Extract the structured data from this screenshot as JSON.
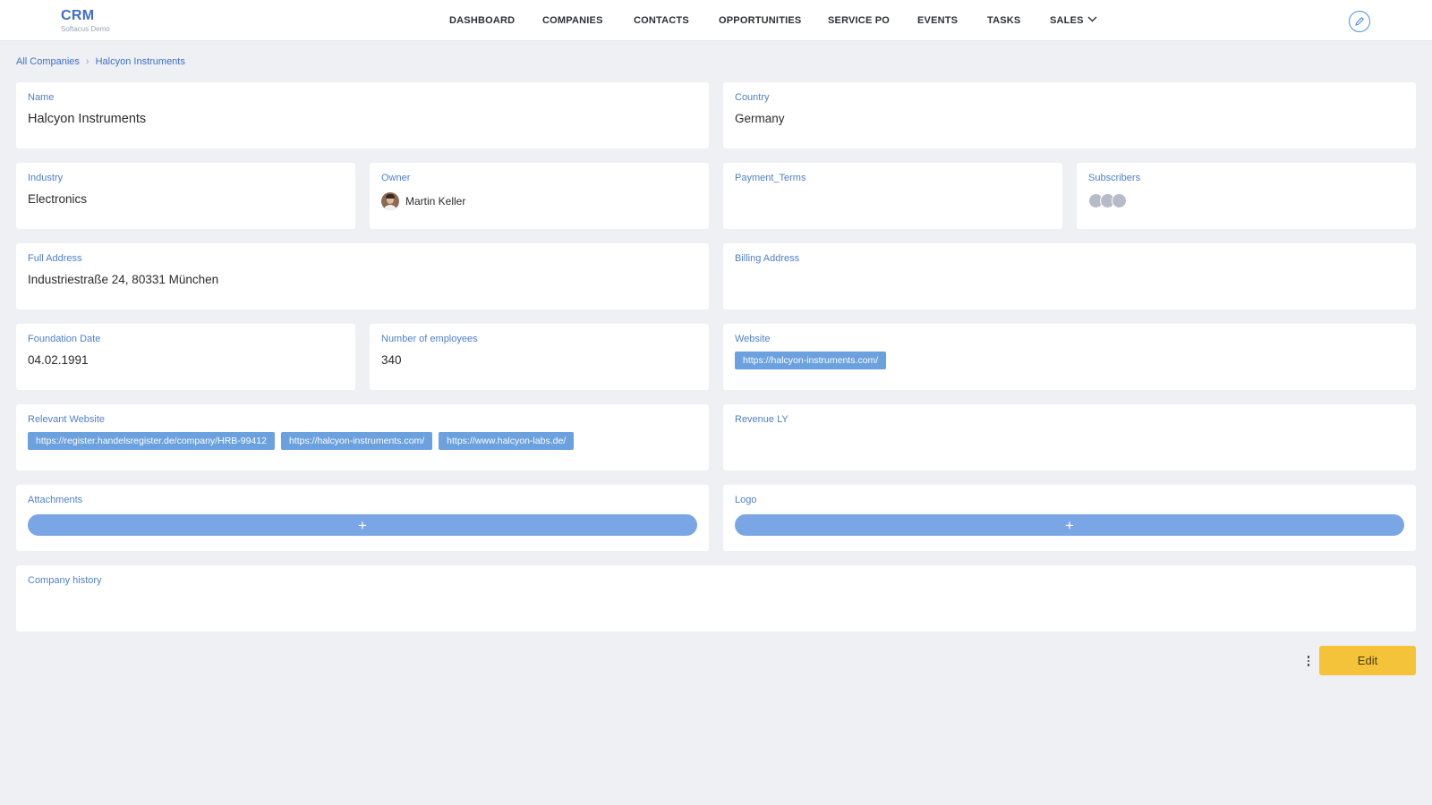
{
  "app": {
    "title": "CRM",
    "subtitle": "Softacus Demo"
  },
  "nav": {
    "items": [
      "DASHBOARD",
      "COMPANIES",
      "CONTACTS",
      "OPPORTUNITIES",
      "SERVICE PO",
      "EVENTS",
      "TASKS",
      "SALES"
    ],
    "edit_icon": "pencil-icon"
  },
  "breadcrumb": [
    "All Companies",
    "Halcyon Instruments"
  ],
  "fields": {
    "name": {
      "label": "Name",
      "value": "Halcyon Instruments"
    },
    "country": {
      "label": "Country",
      "value": "Germany"
    },
    "industry": {
      "label": "Industry",
      "value": "Electronics"
    },
    "owner": {
      "label": "Owner",
      "value": "Martin Keller"
    },
    "payment_terms": {
      "label": "Payment_Terms",
      "value": ""
    },
    "subscribers": {
      "label": "Subscribers",
      "count": 3
    },
    "full_address": {
      "label": "Full Address",
      "value": "Industriestraße 24, 80331 München"
    },
    "billing_address": {
      "label": "Billing Address",
      "value": ""
    },
    "foundation_date": {
      "label": "Foundation Date",
      "value": "04.02.1991"
    },
    "employees": {
      "label": "Number of employees",
      "value": "340"
    },
    "website": {
      "label": "Website",
      "links": [
        "https://halcyon-instruments.com/"
      ]
    },
    "relevant_website": {
      "label": "Relevant Website",
      "links": [
        "https://register.handelsregister.de/company/HRB-99412",
        "https://halcyon-instruments.com/",
        "https://www.halcyon-labs.de/"
      ]
    },
    "revenue_ly": {
      "label": "Revenue LY",
      "value": ""
    },
    "attachments": {
      "label": "Attachments",
      "add": "+"
    },
    "logo": {
      "label": "Logo",
      "add": "+"
    },
    "company_history": {
      "label": "Company history",
      "value": ""
    }
  },
  "actions": {
    "edit": "Edit"
  },
  "colors": {
    "accent": "#3d6ec9",
    "label": "#4f7fcd",
    "chip": "#6ba1df",
    "add_bar": "#7aa6e6",
    "edit_button": "#f4c33a",
    "background": "#eef0f4"
  }
}
